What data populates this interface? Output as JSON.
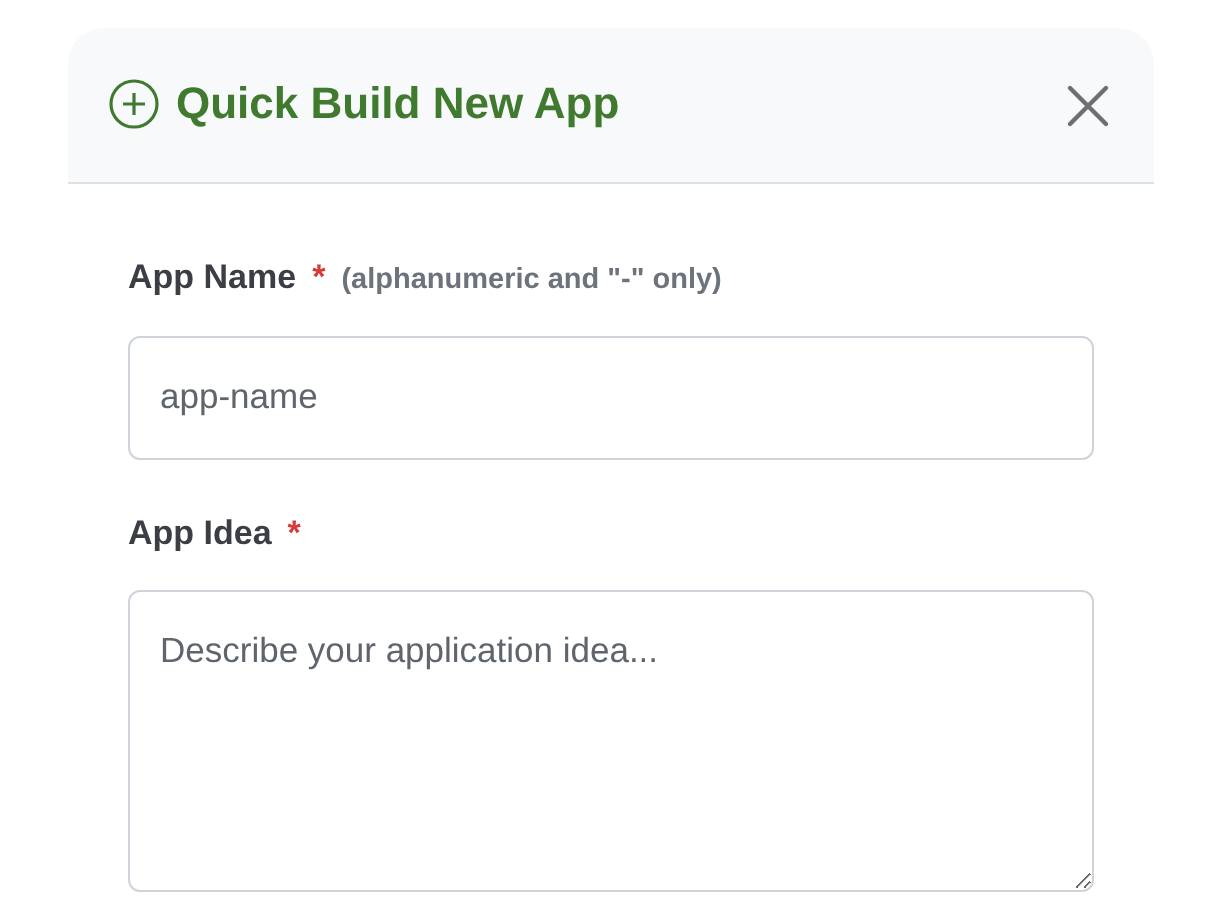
{
  "modal": {
    "title": "Quick Build New App",
    "fields": [
      {
        "kind": "input",
        "label": "App Name",
        "required_mark": "*",
        "hint": "(alphanumeric and \"-\" only)",
        "placeholder": "app-name"
      },
      {
        "kind": "textarea",
        "label": "App Idea",
        "required_mark": "*",
        "placeholder": "Describe your application idea..."
      }
    ]
  }
}
